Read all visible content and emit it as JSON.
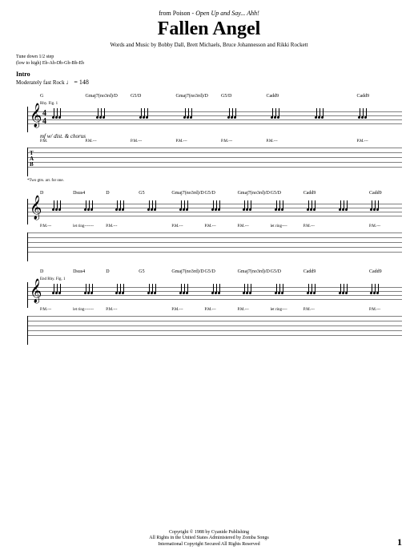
{
  "header": {
    "from_prefix": "from Poison - ",
    "album": "Open Up and Say... Ahh!",
    "title": "Fallen Angel",
    "credits": "Words and Music by Bobby Dall, Brett Michaels, Bruce Johannesson and Rikki Rockett"
  },
  "tuning": {
    "line1": "Tune down 1/2 step",
    "line2": "(low to high) Eb-Ab-Db-Gb-Bb-Eb"
  },
  "intro": {
    "label": "Intro",
    "tempo_text": "Moderately fast Rock",
    "tempo_mark": "♩ = 148"
  },
  "systems": [
    {
      "rhy_fig": "Rhy. Fig. 1",
      "chords": [
        "G",
        "Gmaj7(no3rd)/D",
        "G5/D",
        "Gmaj7(no3rd)/D",
        "G5/D",
        "Cadd9",
        "",
        "Cadd9"
      ],
      "dynamic": "mf",
      "dynamic_note": "w/ dist. & chorus",
      "effects": [
        "P.M.",
        "P.M.---",
        "P.M.---",
        "P.M.---",
        "P.M.---",
        "P.M.---",
        "",
        "P.M.---"
      ],
      "footnote": "*Two gtrs. arr. for one.",
      "show_clef": true,
      "show_tab_label": true,
      "show_timesig": true
    },
    {
      "rhy_fig": "",
      "chords": [
        "D",
        "Dsus4",
        "D",
        "G5",
        "Gmaj7(no3rd)/D",
        "G5/D",
        "Gmaj7(no3rd)/D",
        "G5/D",
        "Cadd9",
        "",
        "Cadd9"
      ],
      "effects": [
        "P.M.---",
        "let ring-------",
        "P.M.---",
        "",
        "P.M.---",
        "P.M.---",
        "P.M.---",
        "let ring----",
        "P.M.---",
        "",
        "P.M.---"
      ],
      "show_clef": true
    },
    {
      "rhy_fig": "End Rhy. Fig. 1",
      "chords": [
        "D",
        "Dsus4",
        "D",
        "G5",
        "Gmaj7(no3rd)/D",
        "G5/D",
        "Gmaj7(no3rd)/D",
        "G5/D",
        "Cadd9",
        "",
        "Cadd9"
      ],
      "effects": [
        "P.M.---",
        "let ring-------",
        "P.M.---",
        "",
        "P.M.---",
        "P.M.---",
        "P.M.---",
        "let ring----",
        "P.M.---",
        "",
        "P.M.---"
      ],
      "show_clef": true
    }
  ],
  "timesig": {
    "top": "4",
    "bottom": "4"
  },
  "tab_label": {
    "t": "T",
    "a": "A",
    "b": "B"
  },
  "footer": {
    "line1": "Copyright © 1988 by Cyanide Publishing",
    "line2": "All Rights in the United States Administered by Zomba Songs",
    "line3": "International Copyright Secured   All Rights Reserved"
  },
  "page_number": "1",
  "clef_glyph": "𝄞"
}
